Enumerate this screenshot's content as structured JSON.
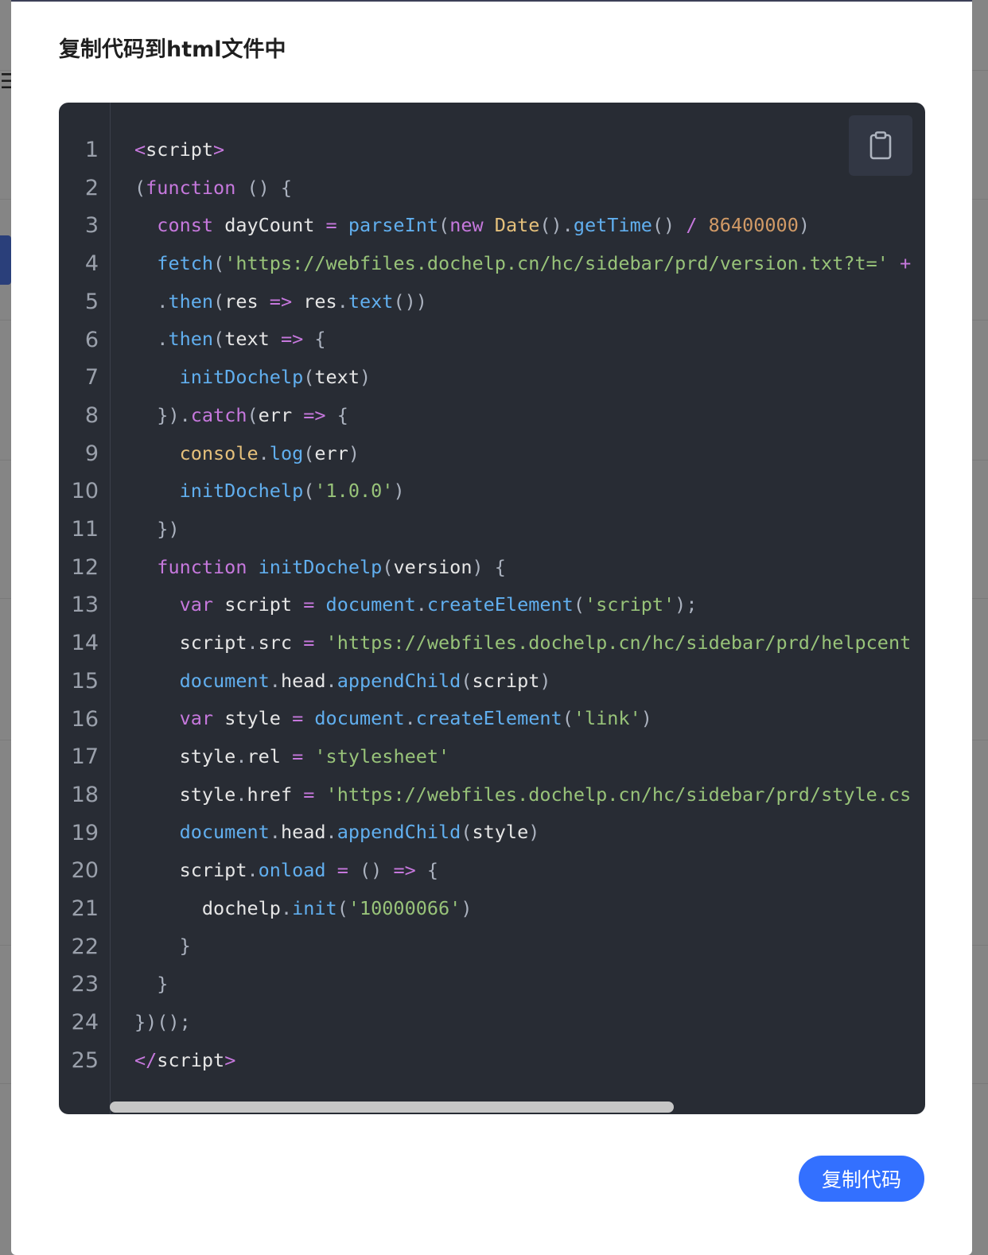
{
  "modal": {
    "title": "复制代码到html文件中",
    "copy_button_label": "复制代码"
  },
  "code": {
    "lines": [
      [
        {
          "t": "<",
          "c": "op"
        },
        {
          "t": "script",
          "c": "var"
        },
        {
          "t": ">",
          "c": "op"
        }
      ],
      [
        {
          "t": "(",
          "c": "punct"
        },
        {
          "t": "function",
          "c": "keyword"
        },
        {
          "t": " () {",
          "c": "punct"
        }
      ],
      [
        {
          "t": "  ",
          "c": "punct"
        },
        {
          "t": "const",
          "c": "keyword"
        },
        {
          "t": " dayCount ",
          "c": "var"
        },
        {
          "t": "=",
          "c": "op"
        },
        {
          "t": " ",
          "c": "punct"
        },
        {
          "t": "parseInt",
          "c": "func"
        },
        {
          "t": "(",
          "c": "punct"
        },
        {
          "t": "new",
          "c": "keyword"
        },
        {
          "t": " ",
          "c": "punct"
        },
        {
          "t": "Date",
          "c": "class"
        },
        {
          "t": "().",
          "c": "punct"
        },
        {
          "t": "getTime",
          "c": "func"
        },
        {
          "t": "() ",
          "c": "punct"
        },
        {
          "t": "/",
          "c": "op"
        },
        {
          "t": " ",
          "c": "punct"
        },
        {
          "t": "86400000",
          "c": "number"
        },
        {
          "t": ")",
          "c": "punct"
        }
      ],
      [
        {
          "t": "  ",
          "c": "punct"
        },
        {
          "t": "fetch",
          "c": "func"
        },
        {
          "t": "(",
          "c": "punct"
        },
        {
          "t": "'https://webfiles.dochelp.cn/hc/sidebar/prd/version.txt?t='",
          "c": "string"
        },
        {
          "t": " +",
          "c": "op"
        }
      ],
      [
        {
          "t": "  .",
          "c": "punct"
        },
        {
          "t": "then",
          "c": "func"
        },
        {
          "t": "(",
          "c": "punct"
        },
        {
          "t": "res ",
          "c": "var"
        },
        {
          "t": "=>",
          "c": "op"
        },
        {
          "t": " res",
          "c": "var"
        },
        {
          "t": ".",
          "c": "punct"
        },
        {
          "t": "text",
          "c": "func"
        },
        {
          "t": "())",
          "c": "punct"
        }
      ],
      [
        {
          "t": "  .",
          "c": "punct"
        },
        {
          "t": "then",
          "c": "func"
        },
        {
          "t": "(",
          "c": "punct"
        },
        {
          "t": "text ",
          "c": "var"
        },
        {
          "t": "=>",
          "c": "op"
        },
        {
          "t": " {",
          "c": "punct"
        }
      ],
      [
        {
          "t": "    ",
          "c": "punct"
        },
        {
          "t": "initDochelp",
          "c": "func"
        },
        {
          "t": "(",
          "c": "punct"
        },
        {
          "t": "text",
          "c": "var"
        },
        {
          "t": ")",
          "c": "punct"
        }
      ],
      [
        {
          "t": "  }).",
          "c": "punct"
        },
        {
          "t": "catch",
          "c": "keyword"
        },
        {
          "t": "(",
          "c": "punct"
        },
        {
          "t": "err ",
          "c": "var"
        },
        {
          "t": "=>",
          "c": "op"
        },
        {
          "t": " {",
          "c": "punct"
        }
      ],
      [
        {
          "t": "    ",
          "c": "punct"
        },
        {
          "t": "console",
          "c": "class"
        },
        {
          "t": ".",
          "c": "punct"
        },
        {
          "t": "log",
          "c": "func"
        },
        {
          "t": "(",
          "c": "punct"
        },
        {
          "t": "err",
          "c": "var"
        },
        {
          "t": ")",
          "c": "punct"
        }
      ],
      [
        {
          "t": "    ",
          "c": "punct"
        },
        {
          "t": "initDochelp",
          "c": "func"
        },
        {
          "t": "(",
          "c": "punct"
        },
        {
          "t": "'1.0.0'",
          "c": "string"
        },
        {
          "t": ")",
          "c": "punct"
        }
      ],
      [
        {
          "t": "  })",
          "c": "punct"
        }
      ],
      [
        {
          "t": "  ",
          "c": "punct"
        },
        {
          "t": "function",
          "c": "keyword"
        },
        {
          "t": " ",
          "c": "punct"
        },
        {
          "t": "initDochelp",
          "c": "func"
        },
        {
          "t": "(",
          "c": "punct"
        },
        {
          "t": "version",
          "c": "var"
        },
        {
          "t": ") {",
          "c": "punct"
        }
      ],
      [
        {
          "t": "    ",
          "c": "punct"
        },
        {
          "t": "var",
          "c": "keyword"
        },
        {
          "t": " script ",
          "c": "var"
        },
        {
          "t": "=",
          "c": "op"
        },
        {
          "t": " ",
          "c": "punct"
        },
        {
          "t": "document",
          "c": "func"
        },
        {
          "t": ".",
          "c": "punct"
        },
        {
          "t": "createElement",
          "c": "func"
        },
        {
          "t": "(",
          "c": "punct"
        },
        {
          "t": "'script'",
          "c": "string"
        },
        {
          "t": ");",
          "c": "punct"
        }
      ],
      [
        {
          "t": "    script",
          "c": "var"
        },
        {
          "t": ".",
          "c": "punct"
        },
        {
          "t": "src ",
          "c": "var"
        },
        {
          "t": "=",
          "c": "op"
        },
        {
          "t": " ",
          "c": "punct"
        },
        {
          "t": "'https://webfiles.dochelp.cn/hc/sidebar/prd/helpcent",
          "c": "string"
        }
      ],
      [
        {
          "t": "    ",
          "c": "punct"
        },
        {
          "t": "document",
          "c": "func"
        },
        {
          "t": ".",
          "c": "punct"
        },
        {
          "t": "head",
          "c": "var"
        },
        {
          "t": ".",
          "c": "punct"
        },
        {
          "t": "appendChild",
          "c": "func"
        },
        {
          "t": "(",
          "c": "punct"
        },
        {
          "t": "script",
          "c": "var"
        },
        {
          "t": ")",
          "c": "punct"
        }
      ],
      [
        {
          "t": "    ",
          "c": "punct"
        },
        {
          "t": "var",
          "c": "keyword"
        },
        {
          "t": " style ",
          "c": "var"
        },
        {
          "t": "=",
          "c": "op"
        },
        {
          "t": " ",
          "c": "punct"
        },
        {
          "t": "document",
          "c": "func"
        },
        {
          "t": ".",
          "c": "punct"
        },
        {
          "t": "createElement",
          "c": "func"
        },
        {
          "t": "(",
          "c": "punct"
        },
        {
          "t": "'link'",
          "c": "string"
        },
        {
          "t": ")",
          "c": "punct"
        }
      ],
      [
        {
          "t": "    style",
          "c": "var"
        },
        {
          "t": ".",
          "c": "punct"
        },
        {
          "t": "rel ",
          "c": "var"
        },
        {
          "t": "=",
          "c": "op"
        },
        {
          "t": " ",
          "c": "punct"
        },
        {
          "t": "'stylesheet'",
          "c": "string"
        }
      ],
      [
        {
          "t": "    style",
          "c": "var"
        },
        {
          "t": ".",
          "c": "punct"
        },
        {
          "t": "href ",
          "c": "var"
        },
        {
          "t": "=",
          "c": "op"
        },
        {
          "t": " ",
          "c": "punct"
        },
        {
          "t": "'https://webfiles.dochelp.cn/hc/sidebar/prd/style.cs",
          "c": "string"
        }
      ],
      [
        {
          "t": "    ",
          "c": "punct"
        },
        {
          "t": "document",
          "c": "func"
        },
        {
          "t": ".",
          "c": "punct"
        },
        {
          "t": "head",
          "c": "var"
        },
        {
          "t": ".",
          "c": "punct"
        },
        {
          "t": "appendChild",
          "c": "func"
        },
        {
          "t": "(",
          "c": "punct"
        },
        {
          "t": "style",
          "c": "var"
        },
        {
          "t": ")",
          "c": "punct"
        }
      ],
      [
        {
          "t": "    script",
          "c": "var"
        },
        {
          "t": ".",
          "c": "punct"
        },
        {
          "t": "onload",
          "c": "func"
        },
        {
          "t": " ",
          "c": "punct"
        },
        {
          "t": "=",
          "c": "op"
        },
        {
          "t": " () ",
          "c": "punct"
        },
        {
          "t": "=>",
          "c": "op"
        },
        {
          "t": " {",
          "c": "punct"
        }
      ],
      [
        {
          "t": "      dochelp",
          "c": "var"
        },
        {
          "t": ".",
          "c": "punct"
        },
        {
          "t": "init",
          "c": "func"
        },
        {
          "t": "(",
          "c": "punct"
        },
        {
          "t": "'10000066'",
          "c": "string"
        },
        {
          "t": ")",
          "c": "punct"
        }
      ],
      [
        {
          "t": "    }",
          "c": "punct"
        }
      ],
      [
        {
          "t": "  }",
          "c": "punct"
        }
      ],
      [
        {
          "t": "})();",
          "c": "punct"
        }
      ],
      [
        {
          "t": "</",
          "c": "op"
        },
        {
          "t": "script",
          "c": "var"
        },
        {
          "t": ">",
          "c": "op"
        }
      ]
    ]
  },
  "icons": {
    "copy": "clipboard-icon"
  },
  "colors": {
    "accent": "#3370ff",
    "code_bg": "#282c34"
  }
}
